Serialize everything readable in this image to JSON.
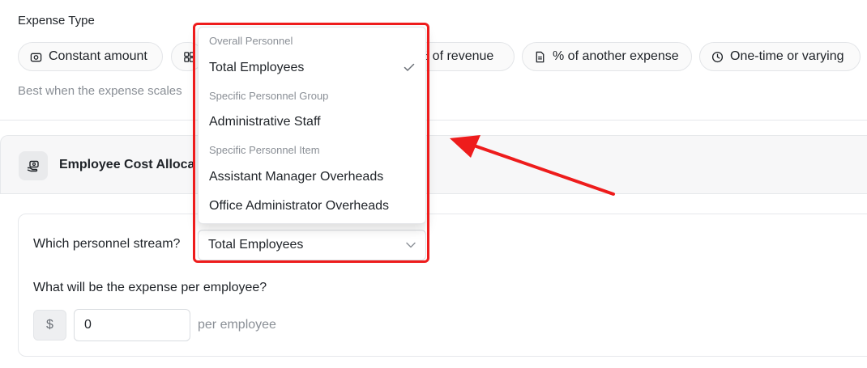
{
  "expense_type": {
    "label": "Expense Type",
    "options": [
      {
        "label": "Constant amount",
        "icon": "camera-icon"
      },
      {
        "label": "",
        "icon": "grid-icon"
      },
      {
        "label": "% of revenue",
        "icon": ""
      },
      {
        "label": "% of another expense",
        "icon": "document-icon"
      },
      {
        "label": "One-time or varying",
        "icon": "clock-icon"
      }
    ],
    "helper_text": "Best when the expense scales"
  },
  "allocation": {
    "icon": "cash-hand-icon",
    "title": "Employee Cost Alloca"
  },
  "form": {
    "stream_question": "Which personnel stream?",
    "stream_value": "Total Employees",
    "expense_question": "What will be the expense per employee?",
    "currency_symbol": "$",
    "amount_value": "0",
    "unit_suffix": "per employee"
  },
  "dropdown": {
    "groups": [
      {
        "label": "Overall Personnel",
        "items": [
          {
            "label": "Total Employees",
            "selected": true
          }
        ]
      },
      {
        "label": "Specific Personnel Group",
        "items": [
          {
            "label": "Administrative Staff",
            "selected": false
          }
        ]
      },
      {
        "label": "Specific Personnel Item",
        "items": [
          {
            "label": "Assistant Manager Overheads",
            "selected": false
          },
          {
            "label": "Office Administrator Overheads",
            "selected": false
          }
        ]
      }
    ]
  },
  "annotation": {
    "color": "#ee1c1c"
  }
}
